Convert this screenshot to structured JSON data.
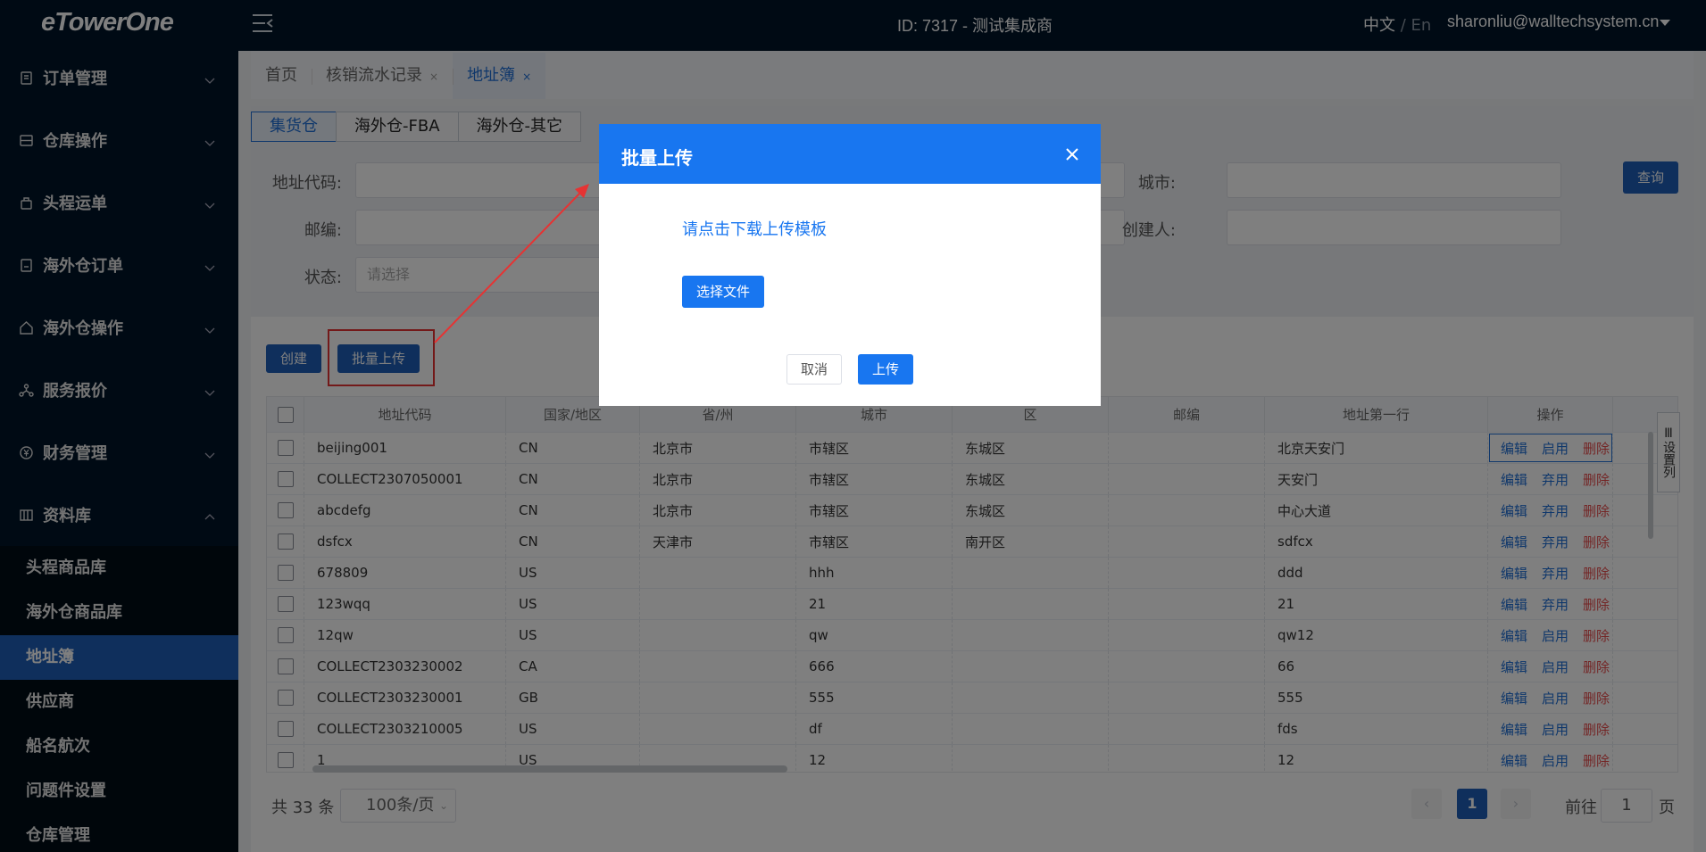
{
  "app": {
    "logo": "eTowerOne"
  },
  "header": {
    "id_text": "ID: 7317 - 测试集成商",
    "lang_active": "中文",
    "lang_sep": "/",
    "lang_other": "En",
    "user": "sharonliu@walltechsystem.cn"
  },
  "sidebar": {
    "groups": [
      {
        "label": "订单管理",
        "icon": "order-icon"
      },
      {
        "label": "仓库操作",
        "icon": "warehouse-icon"
      },
      {
        "label": "头程运单",
        "icon": "waybill-icon"
      },
      {
        "label": "海外仓订单",
        "icon": "overseas-order-icon"
      },
      {
        "label": "海外仓操作",
        "icon": "overseas-ops-icon"
      },
      {
        "label": "服务报价",
        "icon": "quote-icon"
      },
      {
        "label": "财务管理",
        "icon": "finance-icon"
      },
      {
        "label": "资料库",
        "icon": "library-icon"
      }
    ],
    "subitems": [
      "头程商品库",
      "海外仓商品库",
      "地址簿",
      "供应商",
      "船名航次",
      "问题件设置",
      "仓库管理"
    ]
  },
  "tags": [
    {
      "label": "首页"
    },
    {
      "label": "核销流水记录",
      "close": "×"
    },
    {
      "label": "地址簿",
      "close": "×"
    }
  ],
  "warehouse_tabs": [
    "集货仓",
    "海外仓-FBA",
    "海外仓-其它"
  ],
  "filters": {
    "address_code": "地址代码:",
    "city": "城市:",
    "zip": "邮编:",
    "creator": "创建人:",
    "status": "状态:",
    "status_placeholder": "请选择",
    "query": "查询"
  },
  "toolbar": {
    "create": "创建",
    "batch_upload": "批量上传"
  },
  "table": {
    "headers": [
      "地址代码",
      "国家/地区",
      "省/州",
      "城市",
      "区",
      "邮编",
      "地址第一行",
      "操作"
    ],
    "set_columns": "设置列",
    "op_edit": "编辑",
    "op_delete": "删除",
    "rows": [
      {
        "code": "beijing001",
        "country": "CN",
        "province": "北京市",
        "city": "市辖区",
        "district": "东城区",
        "zip": "",
        "addr": "北京天安门",
        "toggle": "启用"
      },
      {
        "code": "COLLECT2307050001",
        "country": "CN",
        "province": "北京市",
        "city": "市辖区",
        "district": "东城区",
        "zip": "",
        "addr": "天安门",
        "toggle": "弃用"
      },
      {
        "code": "abcdefg",
        "country": "CN",
        "province": "北京市",
        "city": "市辖区",
        "district": "东城区",
        "zip": "",
        "addr": "中心大道",
        "toggle": "弃用"
      },
      {
        "code": "dsfcx",
        "country": "CN",
        "province": "天津市",
        "city": "市辖区",
        "district": "南开区",
        "zip": "",
        "addr": "sdfcx",
        "toggle": "弃用"
      },
      {
        "code": "678809",
        "country": "US",
        "province": "",
        "city": "hhh",
        "district": "",
        "zip": "",
        "addr": "ddd",
        "toggle": "弃用"
      },
      {
        "code": "123wqq",
        "country": "US",
        "province": "",
        "city": "21",
        "district": "",
        "zip": "",
        "addr": "21",
        "toggle": "弃用"
      },
      {
        "code": "12qw",
        "country": "US",
        "province": "",
        "city": "qw",
        "district": "",
        "zip": "",
        "addr": "qw12",
        "toggle": "启用"
      },
      {
        "code": "COLLECT2303230002",
        "country": "CA",
        "province": "",
        "city": "666",
        "district": "",
        "zip": "",
        "addr": "66",
        "toggle": "启用"
      },
      {
        "code": "COLLECT2303230001",
        "country": "GB",
        "province": "",
        "city": "555",
        "district": "",
        "zip": "",
        "addr": "555",
        "toggle": "启用"
      },
      {
        "code": "COLLECT2303210005",
        "country": "US",
        "province": "",
        "city": "df",
        "district": "",
        "zip": "",
        "addr": "fds",
        "toggle": "启用"
      },
      {
        "code": "1",
        "country": "US",
        "province": "",
        "city": "12",
        "district": "",
        "zip": "",
        "addr": "12",
        "toggle": "启用"
      }
    ]
  },
  "pager": {
    "total": "共 33 条",
    "size": "100条/页",
    "current": "1",
    "goto_prefix": "前往",
    "goto_value": "1",
    "goto_suffix": "页"
  },
  "dialog": {
    "title": "批量上传",
    "template_link": "请点击下载上传模板",
    "choose_file": "选择文件",
    "cancel": "取消",
    "upload": "上传"
  },
  "colors": {
    "sidebar_bg": "#001529",
    "primary": "#1876f0",
    "active_menu": "#1f5fb8",
    "annotation": "#e63333",
    "delete": "#e84c4c"
  }
}
